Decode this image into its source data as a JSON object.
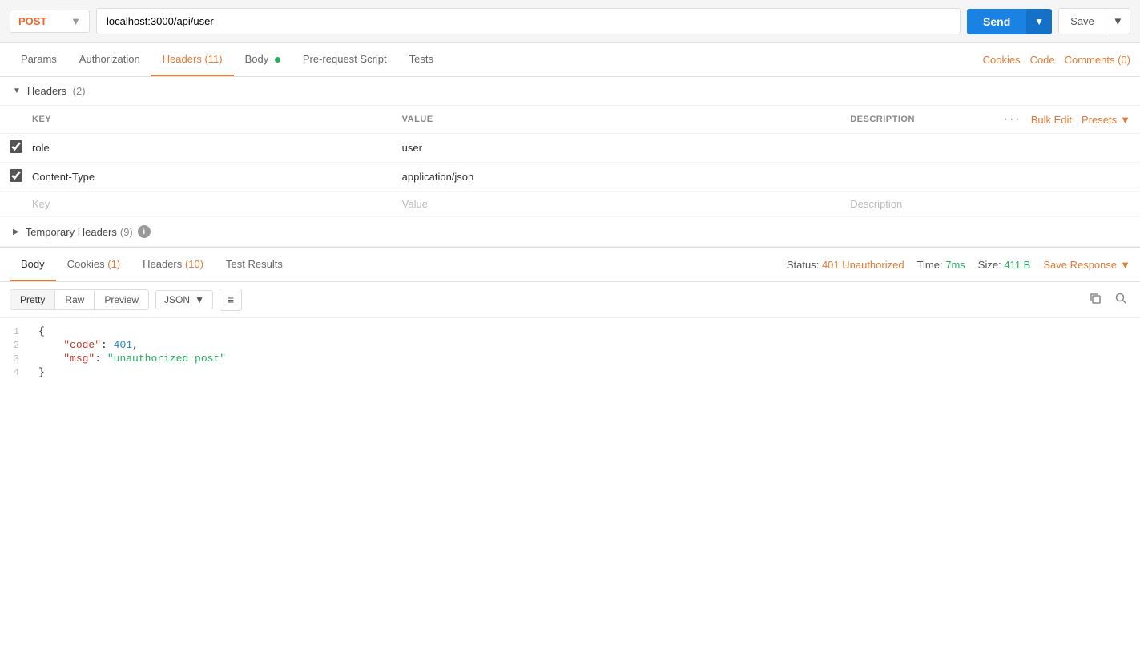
{
  "topBar": {
    "method": "POST",
    "url": "localhost:3000/api/user",
    "sendLabel": "Send",
    "saveLabel": "Save"
  },
  "requestTabs": {
    "items": [
      {
        "id": "params",
        "label": "Params",
        "active": false,
        "badge": null,
        "dot": false
      },
      {
        "id": "authorization",
        "label": "Authorization",
        "active": false,
        "badge": null,
        "dot": false
      },
      {
        "id": "headers",
        "label": "Headers",
        "active": true,
        "badge": "(11)",
        "dot": false
      },
      {
        "id": "body",
        "label": "Body",
        "active": false,
        "badge": null,
        "dot": true
      },
      {
        "id": "prerequest",
        "label": "Pre-request Script",
        "active": false,
        "badge": null,
        "dot": false
      },
      {
        "id": "tests",
        "label": "Tests",
        "active": false,
        "badge": null,
        "dot": false
      }
    ],
    "rightItems": [
      {
        "id": "cookies",
        "label": "Cookies"
      },
      {
        "id": "code",
        "label": "Code"
      },
      {
        "id": "comments",
        "label": "Comments (0)"
      }
    ]
  },
  "headersSection": {
    "title": "Headers",
    "count": "(2)",
    "columns": {
      "key": "KEY",
      "value": "VALUE",
      "description": "DESCRIPTION"
    },
    "bulkEditLabel": "Bulk Edit",
    "presetsLabel": "Presets",
    "rows": [
      {
        "checked": true,
        "key": "role",
        "value": "user",
        "description": ""
      },
      {
        "checked": true,
        "key": "Content-Type",
        "value": "application/json",
        "description": ""
      }
    ],
    "placeholderRow": {
      "key": "Key",
      "value": "Value",
      "description": "Description"
    }
  },
  "temporaryHeaders": {
    "title": "Temporary Headers",
    "count": "(9)"
  },
  "responseTabs": {
    "items": [
      {
        "id": "body",
        "label": "Body",
        "active": true
      },
      {
        "id": "cookies",
        "label": "Cookies",
        "badge": "(1)"
      },
      {
        "id": "headers",
        "label": "Headers",
        "badge": "(10)"
      },
      {
        "id": "testresults",
        "label": "Test Results"
      }
    ],
    "status": {
      "label": "Status:",
      "value": "401 Unauthorized"
    },
    "time": {
      "label": "Time:",
      "value": "7ms"
    },
    "size": {
      "label": "Size:",
      "value": "411 B"
    },
    "saveResponseLabel": "Save Response"
  },
  "formatBar": {
    "tabs": [
      {
        "id": "pretty",
        "label": "Pretty",
        "active": true
      },
      {
        "id": "raw",
        "label": "Raw",
        "active": false
      },
      {
        "id": "preview",
        "label": "Preview",
        "active": false
      }
    ],
    "format": "JSON"
  },
  "codeBlock": {
    "lines": [
      {
        "num": 1,
        "content": "{",
        "type": "brace-open"
      },
      {
        "num": 2,
        "content": "  \"code\": 401,",
        "type": "key-num",
        "key": "\"code\"",
        "value": "401"
      },
      {
        "num": 3,
        "content": "  \"msg\": \"unauthorized post\"",
        "type": "key-str",
        "key": "\"msg\"",
        "value": "\"unauthorized post\""
      },
      {
        "num": 4,
        "content": "}",
        "type": "brace-close"
      }
    ]
  }
}
